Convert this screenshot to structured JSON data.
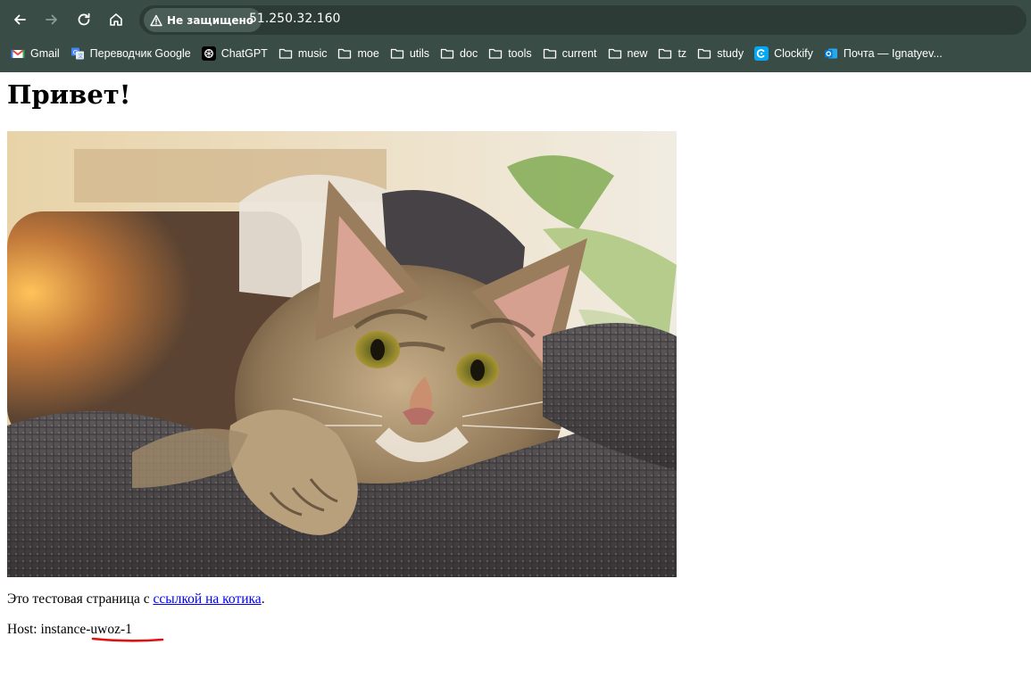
{
  "browser": {
    "security_label": "Не защищено",
    "url": "51.250.32.160",
    "bookmarks": [
      {
        "label": "Gmail",
        "icon": "gmail-icon"
      },
      {
        "label": "Переводчик Google",
        "icon": "google-translate-icon"
      },
      {
        "label": "ChatGPT",
        "icon": "chatgpt-icon"
      },
      {
        "label": "music",
        "icon": "folder-icon"
      },
      {
        "label": "moe",
        "icon": "folder-icon"
      },
      {
        "label": "utils",
        "icon": "folder-icon"
      },
      {
        "label": "doc",
        "icon": "folder-icon"
      },
      {
        "label": "tools",
        "icon": "folder-icon"
      },
      {
        "label": "current",
        "icon": "folder-icon"
      },
      {
        "label": "new",
        "icon": "folder-icon"
      },
      {
        "label": "tz",
        "icon": "folder-icon"
      },
      {
        "label": "study",
        "icon": "folder-icon"
      },
      {
        "label": "Clockify",
        "icon": "clockify-icon"
      },
      {
        "label": "Почта — Ignatyev...",
        "icon": "outlook-icon"
      }
    ],
    "colors": {
      "toolbar": "#3a4c46",
      "omnibox": "#2c3b36"
    }
  },
  "page": {
    "title": "Привет!",
    "image_alt": "cat-photo",
    "desc_before": "Это тестовая страница с ",
    "desc_link": "ссылкой на котика",
    "desc_after": ".",
    "host_label": "Host: ",
    "host_value": "instance-uwoz-1",
    "colors": {
      "link": "#0000ee",
      "annotation": "#e01010"
    }
  }
}
